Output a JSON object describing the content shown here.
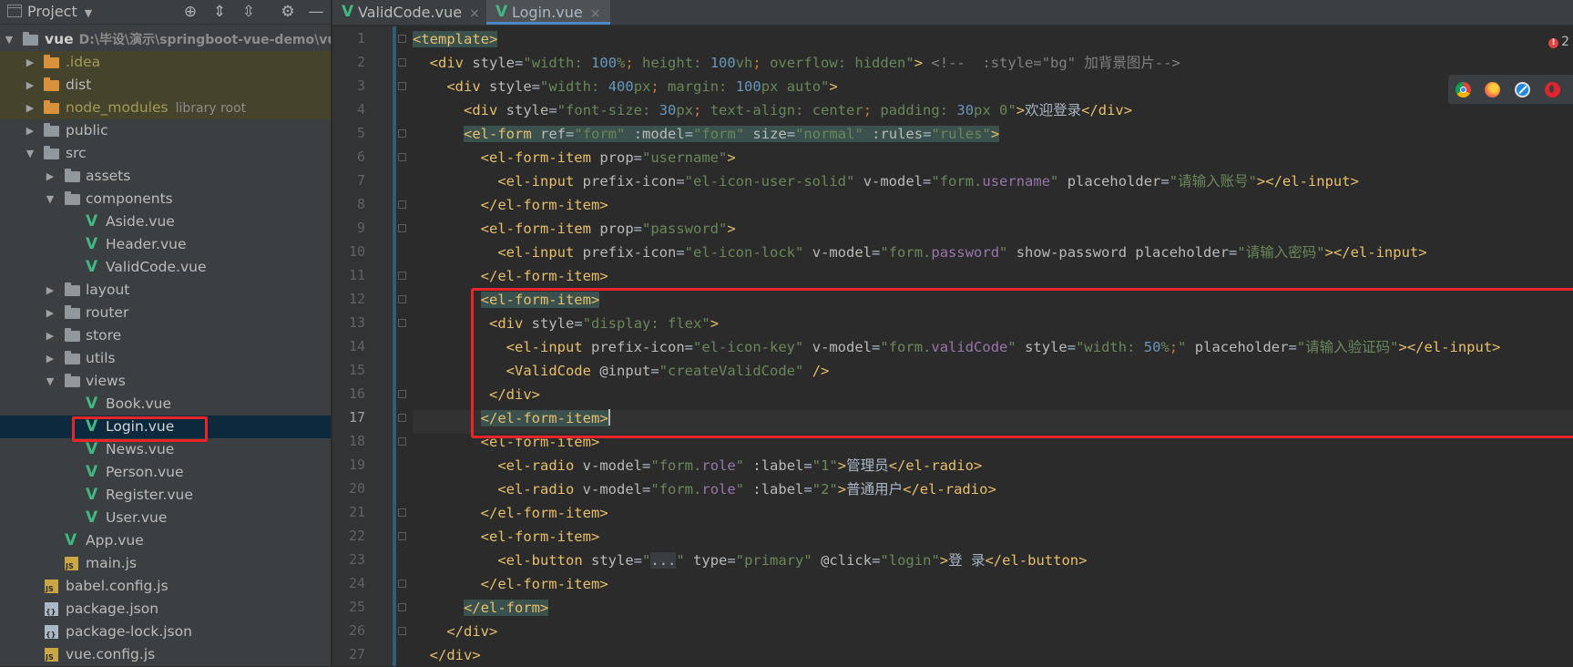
{
  "project_panel": {
    "title": "Project",
    "tree": [
      {
        "label": "vue",
        "path": "D:\\毕设\\演示\\springboot-vue-demo\\vu"
      },
      {
        "label": ".idea"
      },
      {
        "label": "dist"
      },
      {
        "label": "node_modules",
        "hint": "library root"
      },
      {
        "label": "public"
      },
      {
        "label": "src"
      },
      {
        "label": "assets"
      },
      {
        "label": "components"
      },
      {
        "label": "Aside.vue"
      },
      {
        "label": "Header.vue"
      },
      {
        "label": "ValidCode.vue"
      },
      {
        "label": "layout"
      },
      {
        "label": "router"
      },
      {
        "label": "store"
      },
      {
        "label": "utils"
      },
      {
        "label": "views"
      },
      {
        "label": "Book.vue"
      },
      {
        "label": "Login.vue"
      },
      {
        "label": "News.vue"
      },
      {
        "label": "Person.vue"
      },
      {
        "label": "Register.vue"
      },
      {
        "label": "User.vue"
      },
      {
        "label": "App.vue"
      },
      {
        "label": "main.js"
      },
      {
        "label": "babel.config.js"
      },
      {
        "label": "package.json"
      },
      {
        "label": "package-lock.json"
      },
      {
        "label": "vue.config.js"
      }
    ]
  },
  "tabs": [
    {
      "label": "ValidCode.vue",
      "close": "×"
    },
    {
      "label": "Login.vue",
      "close": "×"
    }
  ],
  "editor": {
    "error_count": "2",
    "current_line": "17",
    "lines": [
      {
        "num": "1",
        "code": "<template>"
      },
      {
        "num": "2",
        "code": "  <div style=\"width: 100%; height: 100vh; overflow: hidden\"> <!--  :style=\"bg\" 加背景图片-->"
      },
      {
        "num": "3",
        "code": "    <div style=\"width: 400px; margin: 100px auto\">"
      },
      {
        "num": "4",
        "code": "      <div style=\"font-size: 30px; text-align: center; padding: 30px 0\">欢迎登录</div>"
      },
      {
        "num": "5",
        "code": "      <el-form ref=\"form\" :model=\"form\" size=\"normal\" :rules=\"rules\">"
      },
      {
        "num": "6",
        "code": "        <el-form-item prop=\"username\">"
      },
      {
        "num": "7",
        "code": "          <el-input prefix-icon=\"el-icon-user-solid\" v-model=\"form.username\" placeholder=\"请输入账号\"></el-input>"
      },
      {
        "num": "8",
        "code": "        </el-form-item>"
      },
      {
        "num": "9",
        "code": "        <el-form-item prop=\"password\">"
      },
      {
        "num": "10",
        "code": "          <el-input prefix-icon=\"el-icon-lock\" v-model=\"form.password\" show-password placeholder=\"请输入密码\"></el-input>"
      },
      {
        "num": "11",
        "code": "        </el-form-item>"
      },
      {
        "num": "12",
        "code": "        <el-form-item>"
      },
      {
        "num": "13",
        "code": "         <div style=\"display: flex\">"
      },
      {
        "num": "14",
        "code": "           <el-input prefix-icon=\"el-icon-key\" v-model=\"form.validCode\" style=\"width: 50%;\" placeholder=\"请输入验证码\"></el-input>"
      },
      {
        "num": "15",
        "code": "           <ValidCode @input=\"createValidCode\" />"
      },
      {
        "num": "16",
        "code": "         </div>"
      },
      {
        "num": "17",
        "code": "        </el-form-item>"
      },
      {
        "num": "18",
        "code": "        <el-form-item>"
      },
      {
        "num": "19",
        "code": "          <el-radio v-model=\"form.role\" :label=\"1\">管理员</el-radio>"
      },
      {
        "num": "20",
        "code": "          <el-radio v-model=\"form.role\" :label=\"2\">普通用户</el-radio>"
      },
      {
        "num": "21",
        "code": "        </el-form-item>"
      },
      {
        "num": "22",
        "code": "        <el-form-item>"
      },
      {
        "num": "23",
        "code": "          <el-button style=\"...\" type=\"primary\" @click=\"login\">登 录</el-button>"
      },
      {
        "num": "24",
        "code": "        </el-form-item>"
      },
      {
        "num": "25",
        "code": "      </el-form>"
      },
      {
        "num": "26",
        "code": "    </div>"
      },
      {
        "num": "27",
        "code": "  </div>"
      }
    ]
  },
  "colors": {
    "editor_bg": "#2b2b2b",
    "panel_bg": "#3c3f41",
    "selection": "#0d293e",
    "highlight_box": "#e8262a",
    "vue_green": "#41b883"
  },
  "icons": [
    "locate-icon",
    "expand-all-icon",
    "collapse-all-icon",
    "gear-icon",
    "minimize-icon",
    "chrome-icon",
    "firefox-icon",
    "safari-icon",
    "opera-icon"
  ]
}
